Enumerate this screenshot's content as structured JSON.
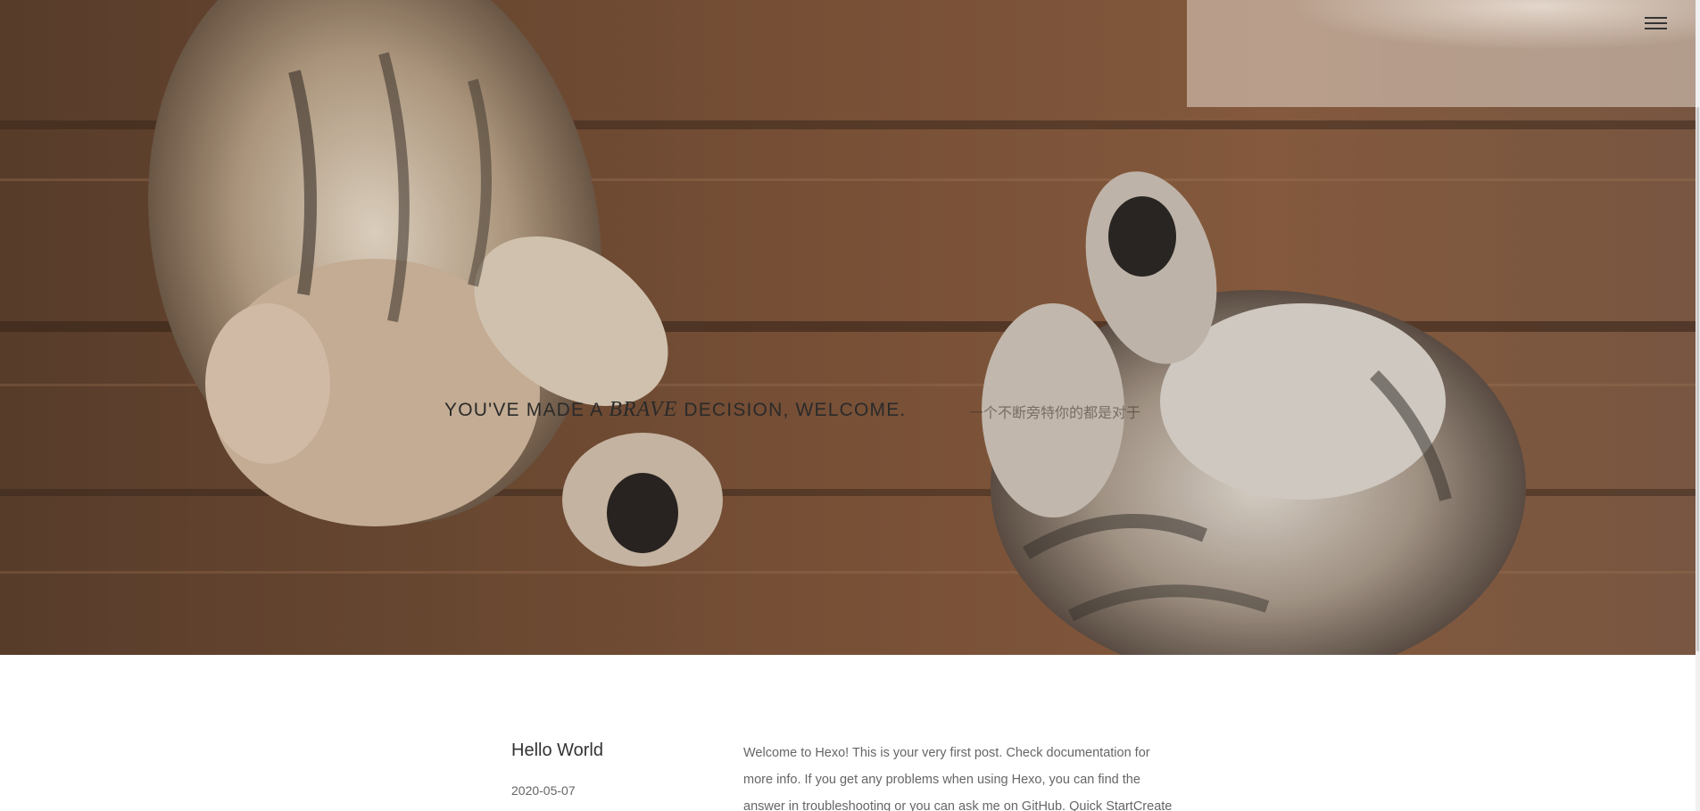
{
  "header": {
    "menu_icon": "hamburger-menu-icon"
  },
  "hero": {
    "tagline_before": "YOU'VE MADE A ",
    "tagline_emphasis": "BRAVE",
    "tagline_after": " DECISION, WELCOME.",
    "subtagline": "一个不断旁特你的都是对于"
  },
  "post": {
    "title": "Hello World",
    "date": "2020-05-07",
    "excerpt_lines": [
      "Welcome to Hexo! This is your very first post. Check documentation for",
      "more info. If you get any problems when using Hexo, you can find the",
      "answer in troubleshooting or you can ask me on GitHub. Quick StartCreate"
    ]
  }
}
